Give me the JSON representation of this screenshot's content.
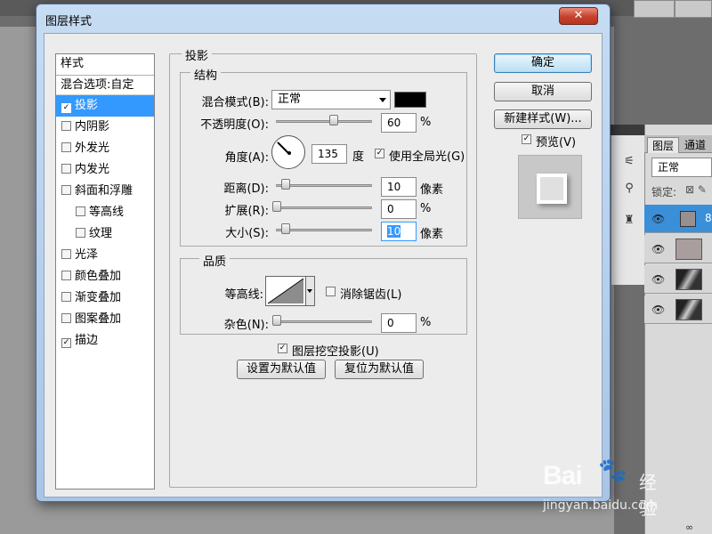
{
  "dialog": {
    "title": "图层样式",
    "close_label": "✕"
  },
  "style_list": {
    "header": "样式",
    "blend_options": "混合选项:自定",
    "items": [
      {
        "label": "投影",
        "checked": true,
        "selected": true
      },
      {
        "label": "内阴影",
        "checked": false
      },
      {
        "label": "外发光",
        "checked": false
      },
      {
        "label": "内发光",
        "checked": false
      },
      {
        "label": "斜面和浮雕",
        "checked": false
      },
      {
        "label": "等高线",
        "checked": false,
        "sub": true
      },
      {
        "label": "纹理",
        "checked": false,
        "sub": true
      },
      {
        "label": "光泽",
        "checked": false
      },
      {
        "label": "颜色叠加",
        "checked": false
      },
      {
        "label": "渐变叠加",
        "checked": false
      },
      {
        "label": "图案叠加",
        "checked": false
      },
      {
        "label": "描边",
        "checked": true
      }
    ]
  },
  "drop_shadow": {
    "title": "投影",
    "structure_title": "结构",
    "blend_mode_label": "混合模式(B):",
    "blend_mode_value": "正常",
    "color": "#000000",
    "opacity_label": "不透明度(O):",
    "opacity_value": "60",
    "opacity_unit": "%",
    "opacity_fraction": 0.6,
    "angle_label": "角度(A):",
    "angle_value": "135",
    "angle_unit": "度",
    "global_light_label": "使用全局光(G)",
    "global_light_checked": true,
    "distance_label": "距离(D):",
    "distance_value": "10",
    "distance_unit": "像素",
    "spread_label": "扩展(R):",
    "spread_value": "0",
    "spread_unit": "%",
    "size_label": "大小(S):",
    "size_value": "10",
    "size_unit": "像素",
    "quality_title": "品质",
    "contour_label": "等高线:",
    "anti_alias_label": "消除锯齿(L)",
    "anti_alias_checked": false,
    "noise_label": "杂色(N):",
    "noise_value": "0",
    "noise_unit": "%",
    "knockout_label": "图层挖空投影(U)",
    "knockout_checked": true,
    "make_default_label": "设置为默认值",
    "reset_default_label": "复位为默认值"
  },
  "buttons": {
    "ok": "确定",
    "cancel": "取消",
    "new_style": "新建样式(W)...",
    "preview_label": "预览(V)",
    "preview_checked": true
  },
  "layers_panel": {
    "tab_layers": "图层",
    "tab_channels": "通道",
    "blend_mode": "正常",
    "lock_label": "锁定:",
    "panel_arrows": "»"
  },
  "watermark": {
    "logo": "Bai",
    "logo_end": "经验",
    "url": "jingyan.baidu.com"
  }
}
